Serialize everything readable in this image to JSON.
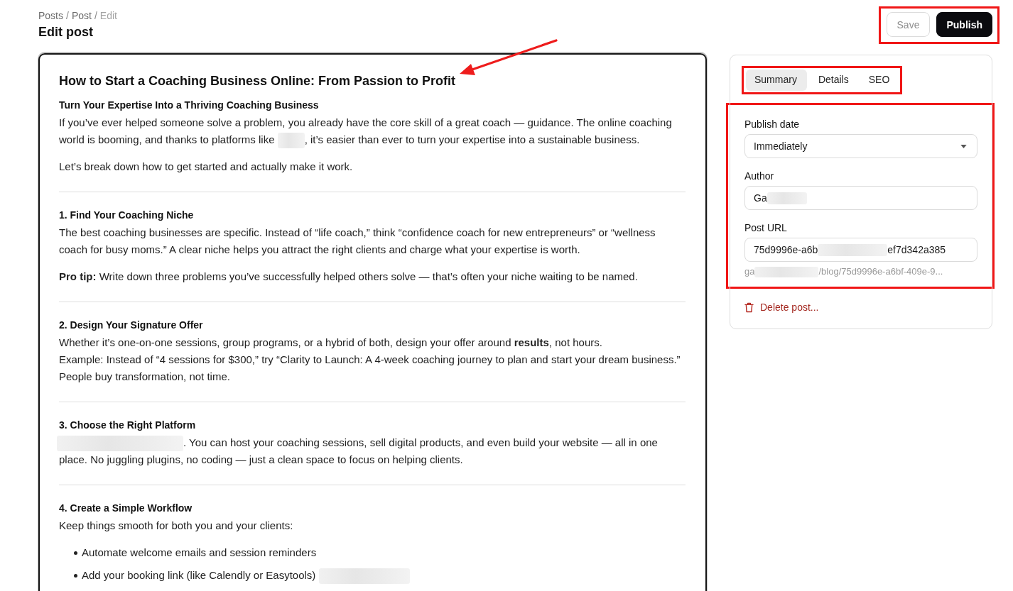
{
  "breadcrumb": [
    {
      "kind": "link",
      "text": "Posts"
    },
    {
      "kind": "separator",
      "text": "/"
    },
    {
      "kind": "link",
      "text": "Post"
    },
    {
      "kind": "separator",
      "text": "/"
    },
    {
      "kind": "current",
      "text": "Edit"
    }
  ],
  "page_title": "Edit post",
  "actions": {
    "highlighted": true,
    "buttons": [
      {
        "kind": "secondary",
        "label": "Save",
        "disabled": true
      },
      {
        "kind": "primary",
        "label": "Publish",
        "disabled": false
      }
    ]
  },
  "editor": {
    "focused": true,
    "blocks": [
      {
        "kind": "title",
        "text": "How to Start a Coaching Business Online: From Passion to Profit",
        "arrow": true
      },
      {
        "kind": "heading",
        "text": "Turn Your Expertise Into a Thriving Coaching Business"
      },
      {
        "kind": "paragraph",
        "parts": [
          {
            "kind": "text",
            "text": "If you’ve ever helped someone solve a problem, you already have the core skill of a great coach — guidance. The online coaching world is booming, and thanks to platforms like "
          },
          {
            "kind": "redacted"
          },
          {
            "kind": "text",
            "text": ", it’s easier than ever to turn your expertise into a sustainable business."
          }
        ]
      },
      {
        "kind": "paragraph",
        "parts": [
          {
            "kind": "text",
            "text": "Let’s break down how to get started and actually make it work."
          }
        ]
      },
      {
        "kind": "divider"
      },
      {
        "kind": "heading",
        "text": "1. Find Your Coaching Niche"
      },
      {
        "kind": "paragraph",
        "parts": [
          {
            "kind": "text",
            "text": "The best coaching businesses are specific. Instead of “life coach,” think “confidence coach for new entrepreneurs” or “wellness coach for busy moms.” A clear niche helps you attract the right clients and charge what your expertise is worth."
          }
        ]
      },
      {
        "kind": "paragraph",
        "parts": [
          {
            "kind": "text",
            "text": "**Pro tip:** Write down three problems you’ve successfully helped others solve — that’s often your niche waiting to be named."
          }
        ]
      },
      {
        "kind": "divider"
      },
      {
        "kind": "heading",
        "text": "2. Design Your Signature Offer"
      },
      {
        "kind": "paragraph",
        "parts": [
          {
            "kind": "text",
            "text": "Whether it’s one-on-one sessions, group programs, or a hybrid of both, design your offer around **results**, not hours."
          },
          {
            "kind": "break"
          },
          {
            "kind": "text",
            "text": "Example: Instead of “4 sessions for $300,” try “Clarity to Launch: A 4-week coaching journey to plan and start your dream business.” People buy transformation, not time."
          }
        ]
      },
      {
        "kind": "divider"
      },
      {
        "kind": "heading",
        "text": "3. Choose the Right Platform"
      },
      {
        "kind": "paragraph",
        "parts": [
          {
            "kind": "redacted"
          },
          {
            "kind": "text",
            "text": ". You can host your coaching sessions, sell digital products, and even build your website — all in one place. No juggling plugins, no coding — just a clean space to focus on helping clients."
          }
        ]
      },
      {
        "kind": "divider"
      },
      {
        "kind": "heading",
        "text": "4. Create a Simple Workflow"
      },
      {
        "kind": "paragraph",
        "parts": [
          {
            "kind": "text",
            "text": "Keep things smooth for both you and your clients:"
          }
        ]
      },
      {
        "kind": "list",
        "items": [
          {
            "parts": [
              {
                "kind": "text",
                "text": "Automate welcome emails and session reminders"
              }
            ]
          },
          {
            "parts": [
              {
                "kind": "text",
                "text": "Add your booking link (like Calendly or Easytools) "
              },
              {
                "kind": "redacted"
              }
            ]
          }
        ]
      }
    ]
  },
  "sidebar": {
    "tabs": {
      "highlighted": true,
      "items": [
        {
          "label": "Summary",
          "selected": true
        },
        {
          "label": "Details",
          "selected": false
        },
        {
          "label": "SEO",
          "selected": false
        }
      ]
    },
    "fields": {
      "highlighted": true,
      "items": [
        {
          "kind": "select",
          "label": "Publish date",
          "value": [
            {
              "kind": "text",
              "text": "Immediately"
            }
          ]
        },
        {
          "kind": "text",
          "label": "Author",
          "value": [
            {
              "kind": "text",
              "text": "Ga"
            },
            {
              "kind": "redacted"
            }
          ]
        },
        {
          "kind": "text",
          "label": "Post URL",
          "value": [
            {
              "kind": "text",
              "text": "75d9996e-a6b"
            },
            {
              "kind": "redacted"
            },
            {
              "kind": "text",
              "text": "ef7d342a385"
            }
          ],
          "hint": [
            {
              "kind": "text",
              "text": "ga"
            },
            {
              "kind": "redacted"
            },
            {
              "kind": "text",
              "text": "/blog/75d9996e-a6bf-409e-9..."
            }
          ]
        }
      ]
    },
    "delete_action": {
      "label": "Delete post..."
    }
  }
}
